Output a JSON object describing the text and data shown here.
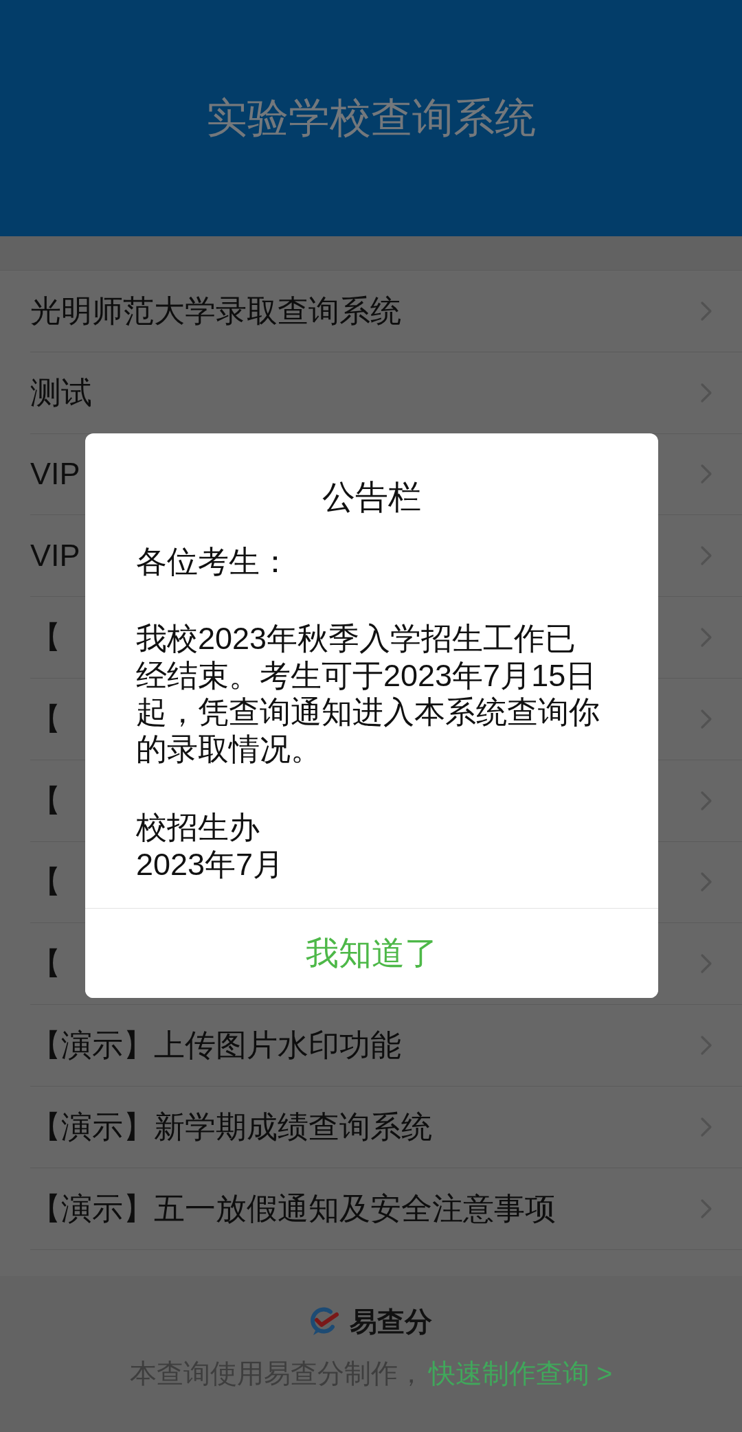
{
  "header": {
    "title": "实验学校查询系统"
  },
  "list": {
    "items": [
      {
        "label": "光明师范大学录取查询系统"
      },
      {
        "label": "测试"
      },
      {
        "label": "VIP"
      },
      {
        "label": "VIP"
      },
      {
        "label": "【"
      },
      {
        "label": "【"
      },
      {
        "label": "【"
      },
      {
        "label": "【"
      },
      {
        "label": "【"
      },
      {
        "label": "【演示】上传图片水印功能"
      },
      {
        "label": "【演示】新学期成绩查询系统"
      },
      {
        "label": "【演示】五一放假通知及安全注意事项"
      }
    ]
  },
  "dialog": {
    "title": "公告栏",
    "greeting": "各位考生：",
    "notice": "我校2023年秋季入学招生工作已经结束。考生可于2023年7月15日起，凭查询通知进入本系统查询你的录取情况。",
    "signature": "校招生办",
    "date": "2023年7月",
    "button": "我知道了"
  },
  "footer": {
    "brand": "易查分",
    "note": "本查询使用易查分制作，",
    "link": "快速制作查询 >"
  }
}
